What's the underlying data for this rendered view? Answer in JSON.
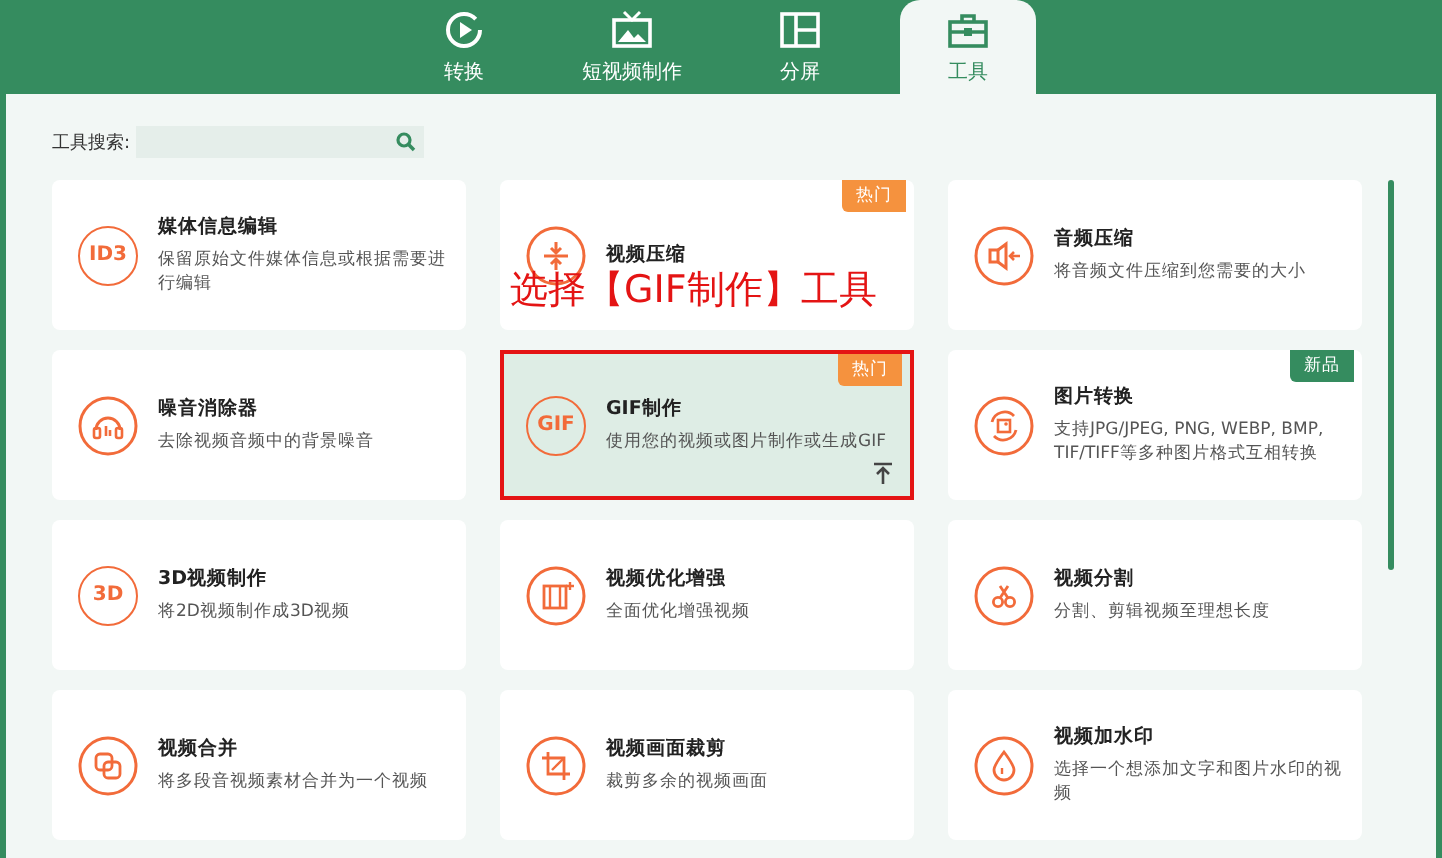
{
  "tabs": [
    {
      "label": "转换",
      "selected": false
    },
    {
      "label": "短视频制作",
      "selected": false
    },
    {
      "label": "分屏",
      "selected": false
    },
    {
      "label": "工具",
      "selected": true
    }
  ],
  "search": {
    "label": "工具搜索:"
  },
  "tools": [
    {
      "title": "媒体信息编辑",
      "description": "保留原始文件媒体信息或根据需要进行编辑",
      "icon_text": "ID3",
      "selected": false
    },
    {
      "title": "视频压缩",
      "badge": {
        "text": "热门",
        "color": "#f5923e"
      },
      "selected": false
    },
    {
      "title": "音频压缩",
      "description": "将音频文件压缩到您需要的大小",
      "selected": false
    },
    {
      "title": "噪音消除器",
      "description": "去除视频音频中的背景噪音",
      "selected": false
    },
    {
      "title": "GIF制作",
      "description": "使用您的视频或图片制作或生成GIF",
      "icon_text": "GIF",
      "badge": {
        "text": "热门",
        "color": "#f5923e"
      },
      "pinned": true,
      "selected": true
    },
    {
      "title": "图片转换",
      "description": "支持JPG/JPEG, PNG, WEBP, BMP, TIF/TIFF等多种图片格式互相转换",
      "badge": {
        "text": "新品",
        "color": "#358c5f"
      },
      "selected": false
    },
    {
      "title": "3D视频制作",
      "description": "将2D视频制作成3D视频",
      "icon_text": "3D",
      "selected": false
    },
    {
      "title": "视频优化增强",
      "description": "全面优化增强视频",
      "selected": false
    },
    {
      "title": "视频分割",
      "description": "分割、剪辑视频至理想长度",
      "selected": false
    },
    {
      "title": "视频合并",
      "description": "将多段音视频素材合并为一个视频",
      "selected": false
    },
    {
      "title": "视频画面裁剪",
      "description": "裁剪多余的视频画面",
      "selected": false
    },
    {
      "title": "视频加水印",
      "description": "选择一个想添加文字和图片水印的视频",
      "selected": false
    }
  ],
  "annotation": "选择【GIF制作】工具"
}
